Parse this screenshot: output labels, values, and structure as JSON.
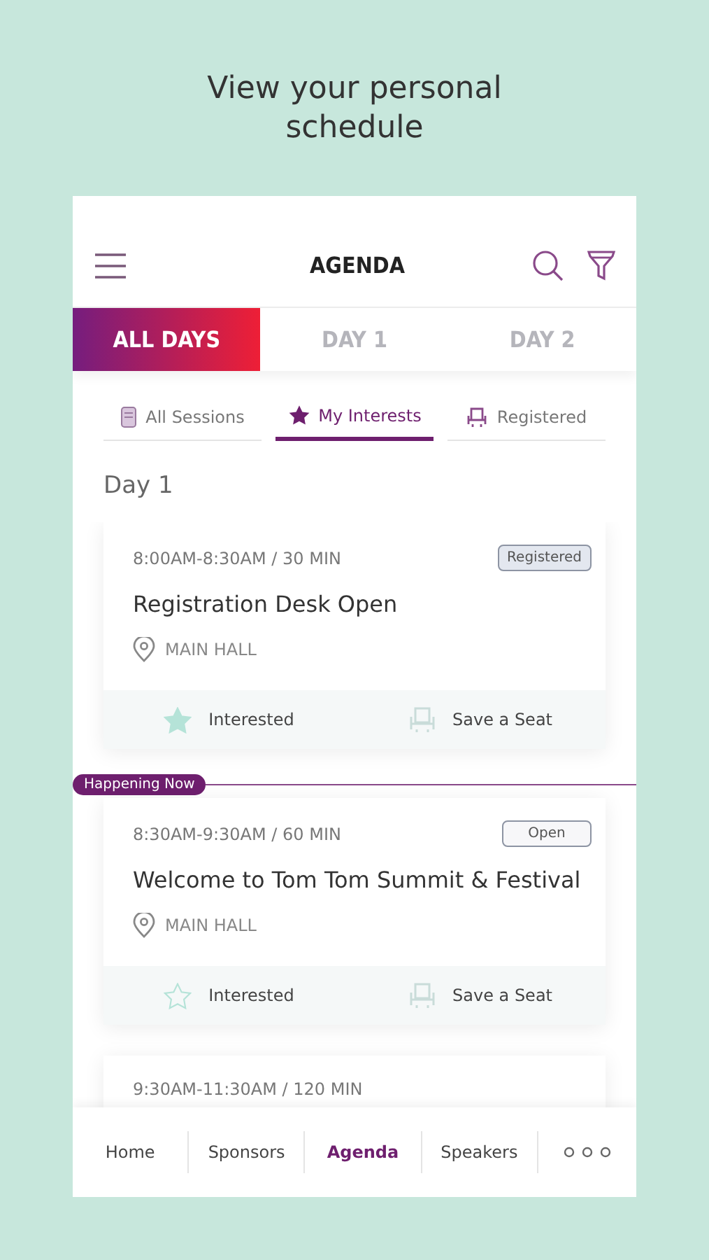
{
  "headline": "View your personal schedule",
  "header": {
    "title": "AGENDA"
  },
  "day_tabs": [
    {
      "label": "ALL DAYS",
      "selected": true
    },
    {
      "label": "DAY 1",
      "selected": false
    },
    {
      "label": "DAY 2",
      "selected": false
    }
  ],
  "filter_tabs": [
    {
      "label": "All Sessions",
      "kind": "sessions",
      "selected": false
    },
    {
      "label": "My Interests",
      "kind": "interests",
      "selected": true
    },
    {
      "label": "Registered",
      "kind": "registered",
      "selected": false
    }
  ],
  "section_title": "Day 1",
  "agenda": [
    {
      "kind": "session",
      "time": "8:00AM-8:30AM",
      "duration": "/ 30 MIN",
      "badge": "Registered",
      "badge_highlighted": true,
      "title": "Registration Desk Open",
      "location": "MAIN HALL",
      "interested": true,
      "interest_label": "Interested",
      "seat_label": "Save a Seat"
    },
    {
      "kind": "marker",
      "label": "Happening Now"
    },
    {
      "kind": "session",
      "time": "8:30AM-9:30AM",
      "duration": "/ 60 MIN",
      "badge": "Open",
      "badge_highlighted": false,
      "title": "Welcome to Tom Tom Summit & Festival",
      "location": "MAIN HALL",
      "interested": false,
      "interest_label": "Interested",
      "seat_label": "Save a Seat"
    },
    {
      "kind": "partial",
      "time": "9:30AM-11:30AM",
      "duration": "/ 120 MIN"
    }
  ],
  "bottom_nav": [
    {
      "label": "Home",
      "selected": false
    },
    {
      "label": "Sponsors",
      "selected": false
    },
    {
      "label": "Agenda",
      "selected": true
    },
    {
      "label": "Speakers",
      "selected": false
    }
  ]
}
